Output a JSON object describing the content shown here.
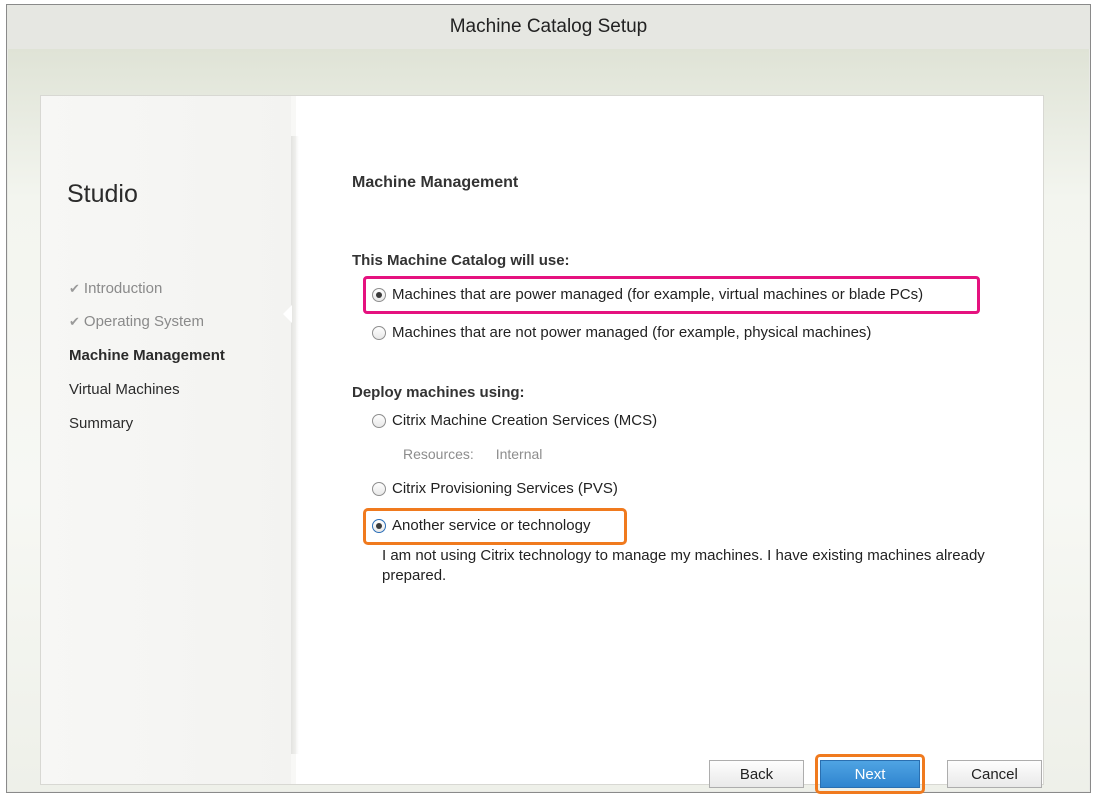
{
  "window": {
    "title": "Machine Catalog Setup"
  },
  "sidebar": {
    "title": "Studio",
    "items": [
      {
        "label": "Introduction",
        "state": "done"
      },
      {
        "label": "Operating System",
        "state": "done"
      },
      {
        "label": "Machine Management",
        "state": "active"
      },
      {
        "label": "Virtual Machines",
        "state": "pending"
      },
      {
        "label": "Summary",
        "state": "pending"
      }
    ]
  },
  "main": {
    "section_title": "Machine Management",
    "catalog_use": {
      "label": "This Machine Catalog will use:",
      "options": [
        {
          "label": "Machines that are power managed (for example, virtual machines or blade PCs)",
          "selected": true
        },
        {
          "label": "Machines that are not power managed (for example, physical machines)",
          "selected": false
        }
      ]
    },
    "deploy": {
      "label": "Deploy machines using:",
      "options": [
        {
          "label": "Citrix Machine Creation Services (MCS)",
          "selected": false
        },
        {
          "label": "Citrix Provisioning Services (PVS)",
          "selected": false
        },
        {
          "label": "Another service or technology",
          "selected": true
        }
      ],
      "resources_label": "Resources:",
      "resources_value": "Internal",
      "description": "I am not using Citrix technology to manage my machines. I have existing machines already prepared."
    }
  },
  "footer": {
    "back_label": "Back",
    "next_label": "Next",
    "cancel_label": "Cancel"
  },
  "highlight_colors": {
    "pink": "#e5127f",
    "orange": "#f07a1e"
  }
}
